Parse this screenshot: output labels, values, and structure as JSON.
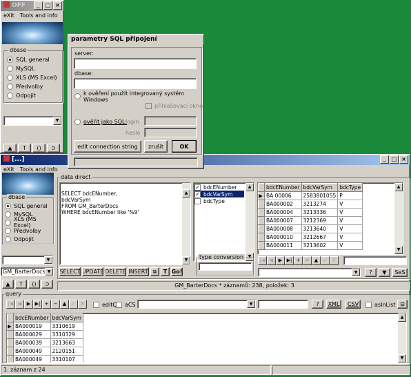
{
  "win_small": {
    "title": "OFF",
    "menu": [
      "eXit",
      "Tools and info"
    ],
    "dbase_label": "dbase",
    "options": [
      {
        "label": "SQL general",
        "checked": true
      },
      {
        "label": "MySQL",
        "checked": false
      },
      {
        "label": "XLS (MS Excel)",
        "checked": false
      },
      {
        "label": "Předvolby",
        "checked": false
      },
      {
        "label": "Odpojit",
        "checked": false
      }
    ],
    "toolbar": [
      "▲",
      "T",
      "()",
      "⊃"
    ]
  },
  "dialog": {
    "title": "parametry SQL připojení",
    "server_label": "server:",
    "server_value": "",
    "dbase_label": "dbase:",
    "dbase_value": "",
    "radio_integrated": "k ověření použít integrovaný systém Windows",
    "checkbox_login": "přihlašovací okno",
    "radio_sql": "ověřit jako SQL:",
    "login_label": "login",
    "password_label": "heslo",
    "edit_button": "edit connection string",
    "cancel_button": "zrušit",
    "ok_button": "OK"
  },
  "win_main": {
    "title": "[...]",
    "menu": [
      "eXit",
      "Tools and info"
    ],
    "dbase_label": "dbase",
    "options": [
      {
        "label": "SQL general",
        "checked": true
      },
      {
        "label": "MySQL",
        "checked": false
      },
      {
        "label": "XLS (MS Excel)",
        "checked": false
      },
      {
        "label": "Předvolby",
        "checked": false
      },
      {
        "label": "Odpojit",
        "checked": false
      }
    ],
    "table_select": "GM_BarterDocs",
    "toolbar": [
      "▲",
      "T",
      "()",
      "⊃"
    ],
    "data_direct_label": "data direct",
    "sql_text": "SELECT bdcENumber,\nbdcVarSym\nFROM GM_BarterDocs\nWHERE bdcENumber like '%9'",
    "columns": [
      {
        "label": "bdcENumber",
        "checked": true,
        "selected": false
      },
      {
        "label": "bdcVarSym",
        "checked": true,
        "selected": true
      },
      {
        "label": "bdcType",
        "checked": false,
        "selected": false
      }
    ],
    "type_conversion_label": "type conversion",
    "sql_buttons": [
      "SELECT",
      "UPDATE",
      "DELETE",
      "INSERT"
    ],
    "go_button": "Go!",
    "ses_button": "SeS",
    "help_button": "?",
    "grid1": {
      "headers": [
        "bdcENumber",
        "bdcVarSym",
        "bdcType"
      ],
      "rows": [
        [
          "BA 00006",
          "2583801055",
          "P"
        ],
        [
          "BA000002",
          "3213274",
          "V"
        ],
        [
          "BA000004",
          "3213336",
          "V"
        ],
        [
          "BA000007",
          "3212369",
          "V"
        ],
        [
          "BA000008",
          "3213640",
          "V"
        ],
        [
          "BA000010",
          "3212667",
          "V"
        ],
        [
          "BA000011",
          "3213602",
          "V"
        ]
      ]
    },
    "status_mid": "GM_BarterDocs * záznamů: 238, položek: 3",
    "query_label": "query",
    "query_controls": {
      "editq": "editQ",
      "acs": "aCS",
      "xml": "XML",
      "csv": "CSV",
      "asinlist": "asInList",
      "help": "?"
    },
    "grid2": {
      "headers": [
        "bdcENumber",
        "bdcVarSym"
      ],
      "rows": [
        [
          "BA000019",
          "3310619"
        ],
        [
          "BA000029",
          "3310329"
        ],
        [
          "BA000039",
          "3213663"
        ],
        [
          "BA000049",
          "2120151"
        ],
        [
          "BA000049",
          "3310107"
        ]
      ]
    },
    "status_bottom": "1. záznam z 24"
  }
}
